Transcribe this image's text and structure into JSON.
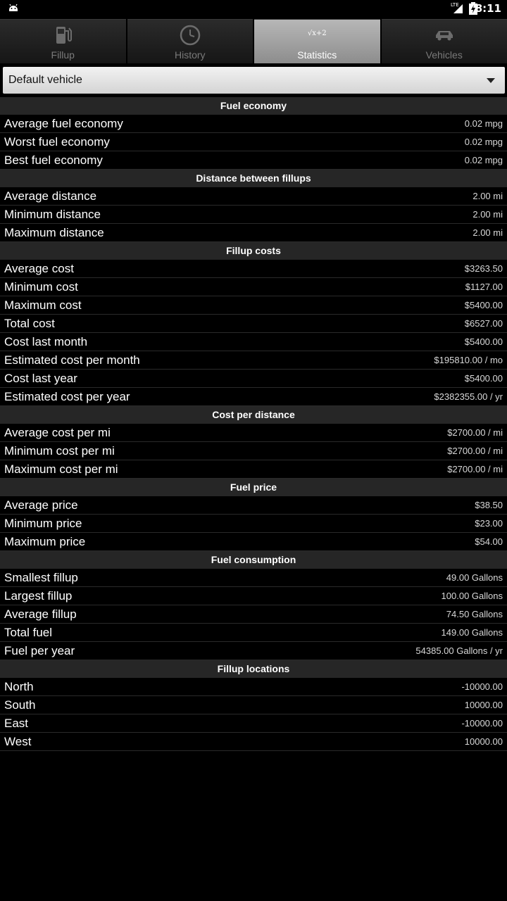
{
  "status_bar": {
    "time": "8:11",
    "network": "LTE"
  },
  "tabs": [
    {
      "label": "Fillup",
      "icon": "fuel-pump-icon"
    },
    {
      "label": "History",
      "icon": "clock-icon"
    },
    {
      "label": "Statistics",
      "icon": "formula-icon",
      "icon_text": "√x+2",
      "active": true
    },
    {
      "label": "Vehicles",
      "icon": "car-icon"
    }
  ],
  "vehicle_selector": {
    "selected": "Default vehicle"
  },
  "sections": [
    {
      "title": "Fuel economy",
      "rows": [
        {
          "label": "Average fuel economy",
          "value": "0.02 mpg"
        },
        {
          "label": "Worst fuel economy",
          "value": "0.02 mpg"
        },
        {
          "label": "Best fuel economy",
          "value": "0.02 mpg"
        }
      ]
    },
    {
      "title": "Distance between fillups",
      "rows": [
        {
          "label": "Average distance",
          "value": "2.00 mi"
        },
        {
          "label": "Minimum distance",
          "value": "2.00 mi"
        },
        {
          "label": "Maximum distance",
          "value": "2.00 mi"
        }
      ]
    },
    {
      "title": "Fillup costs",
      "rows": [
        {
          "label": "Average cost",
          "value": "$3263.50"
        },
        {
          "label": "Minimum cost",
          "value": "$1127.00"
        },
        {
          "label": "Maximum cost",
          "value": "$5400.00"
        },
        {
          "label": "Total cost",
          "value": "$6527.00"
        },
        {
          "label": "Cost last month",
          "value": "$5400.00"
        },
        {
          "label": "Estimated cost per month",
          "value": "$195810.00 / mo"
        },
        {
          "label": "Cost last year",
          "value": "$5400.00"
        },
        {
          "label": "Estimated cost per year",
          "value": "$2382355.00 / yr"
        }
      ]
    },
    {
      "title": "Cost per distance",
      "rows": [
        {
          "label": "Average cost per mi",
          "value": "$2700.00 / mi"
        },
        {
          "label": "Minimum cost per mi",
          "value": "$2700.00 / mi"
        },
        {
          "label": "Maximum cost per mi",
          "value": "$2700.00 / mi"
        }
      ]
    },
    {
      "title": "Fuel price",
      "rows": [
        {
          "label": "Average price",
          "value": "$38.50"
        },
        {
          "label": "Minimum price",
          "value": "$23.00"
        },
        {
          "label": "Maximum price",
          "value": "$54.00"
        }
      ]
    },
    {
      "title": "Fuel consumption",
      "rows": [
        {
          "label": "Smallest fillup",
          "value": "49.00 Gallons"
        },
        {
          "label": "Largest fillup",
          "value": "100.00 Gallons"
        },
        {
          "label": "Average fillup",
          "value": "74.50 Gallons"
        },
        {
          "label": "Total fuel",
          "value": "149.00 Gallons"
        },
        {
          "label": "Fuel per year",
          "value": "54385.00 Gallons / yr"
        }
      ]
    },
    {
      "title": "Fillup locations",
      "rows": [
        {
          "label": "North",
          "value": "-10000.00"
        },
        {
          "label": "South",
          "value": "10000.00"
        },
        {
          "label": "East",
          "value": "-10000.00"
        },
        {
          "label": "West",
          "value": "10000.00"
        }
      ]
    }
  ]
}
